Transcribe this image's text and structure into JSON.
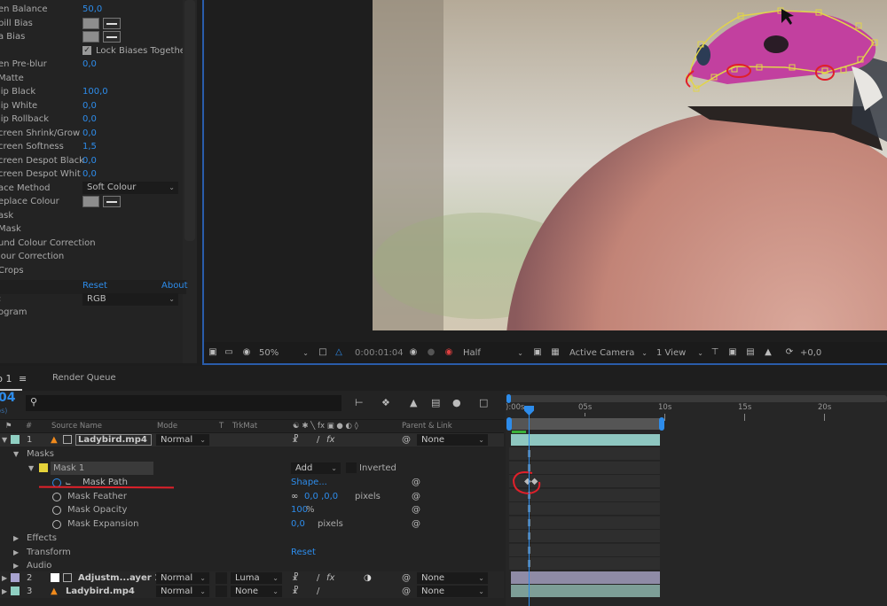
{
  "effect_controls": {
    "rows": [
      {
        "label": "en Balance",
        "value": "50,0"
      },
      {
        "label": "pill Bias",
        "type": "color"
      },
      {
        "label": "a Bias",
        "type": "color"
      },
      {
        "label": "",
        "checkbox": "Lock Biases Togethe",
        "checked": true
      },
      {
        "label": "en Pre-blur",
        "value": "0,0"
      },
      {
        "label": "Matte",
        "value": ""
      },
      {
        "label": "lip Black",
        "value": "100,0"
      },
      {
        "label": "lip White",
        "value": "0,0"
      },
      {
        "label": "lip Rollback",
        "value": "0,0"
      },
      {
        "label": "creen Shrink/Grow",
        "value": "0,0"
      },
      {
        "label": "creen Softness",
        "value": "1,5"
      },
      {
        "label": "creen Despot Black",
        "value": "0,0"
      },
      {
        "label": "creen Despot Whit",
        "value": "0,0"
      },
      {
        "label": "ace Method",
        "dropdown": "Soft Colour"
      },
      {
        "label": "eplace Colour",
        "type": "color"
      },
      {
        "label": "ask",
        "value": ""
      },
      {
        "label": " Mask",
        "value": ""
      },
      {
        "label": "und Colour Correction",
        "value": ""
      },
      {
        "label": "lour Correction",
        "value": ""
      },
      {
        "label": "Crops",
        "value": ""
      }
    ],
    "reset_label": "Reset",
    "about_label": "About",
    "channel_dropdown": "RGB",
    "histogram_label": "ogram"
  },
  "viewer": {
    "zoom": "50%",
    "timecode": "0:00:01:04",
    "resolution": "Half",
    "camera": "Active Camera",
    "views": "1 View",
    "exposure": "+0,0"
  },
  "timeline": {
    "comp_tab": "p 1",
    "render_queue_tab": "Render Queue",
    "current_time": "04",
    "fps_hint": "ps)",
    "search_placeholder": "",
    "columns": {
      "num": "#",
      "source": "Source Name",
      "mode": "Mode",
      "t": "T",
      "trkmat": "TrkMat",
      "parent": "Parent & Link"
    },
    "ruler": [
      "):00s",
      "05s",
      "10s",
      "15s",
      "20s"
    ],
    "layers": [
      {
        "num": "1",
        "name": "Ladybird.mp4",
        "mode": "Normal",
        "trkmat": "",
        "parent": "None",
        "color": "#8fcfc2"
      },
      {
        "num": "2",
        "name": "Adjustm...ayer 1",
        "mode": "Normal",
        "trkmat": "Luma",
        "parent": "None",
        "color": "#a8a3d0"
      },
      {
        "num": "3",
        "name": "Ladybird.mp4",
        "mode": "Normal",
        "trkmat": "None",
        "parent": "None",
        "color": "#8fcfc2"
      }
    ],
    "masks_label": "Masks",
    "mask_name": "Mask 1",
    "mask_mode": "Add",
    "inverted_label": "Inverted",
    "mask_props": [
      {
        "label": "Mask Path",
        "value": "Shape...",
        "unit": ""
      },
      {
        "label": "Mask Feather",
        "value": "0,0 ,0,0",
        "unit": "pixels"
      },
      {
        "label": "Mask Opacity",
        "value": "100",
        "unit": "%"
      },
      {
        "label": "Mask Expansion",
        "value": "0,0",
        "unit": "pixels"
      }
    ],
    "groups": [
      "Effects",
      "Transform",
      "Audio"
    ],
    "transform_reset": "Reset"
  }
}
